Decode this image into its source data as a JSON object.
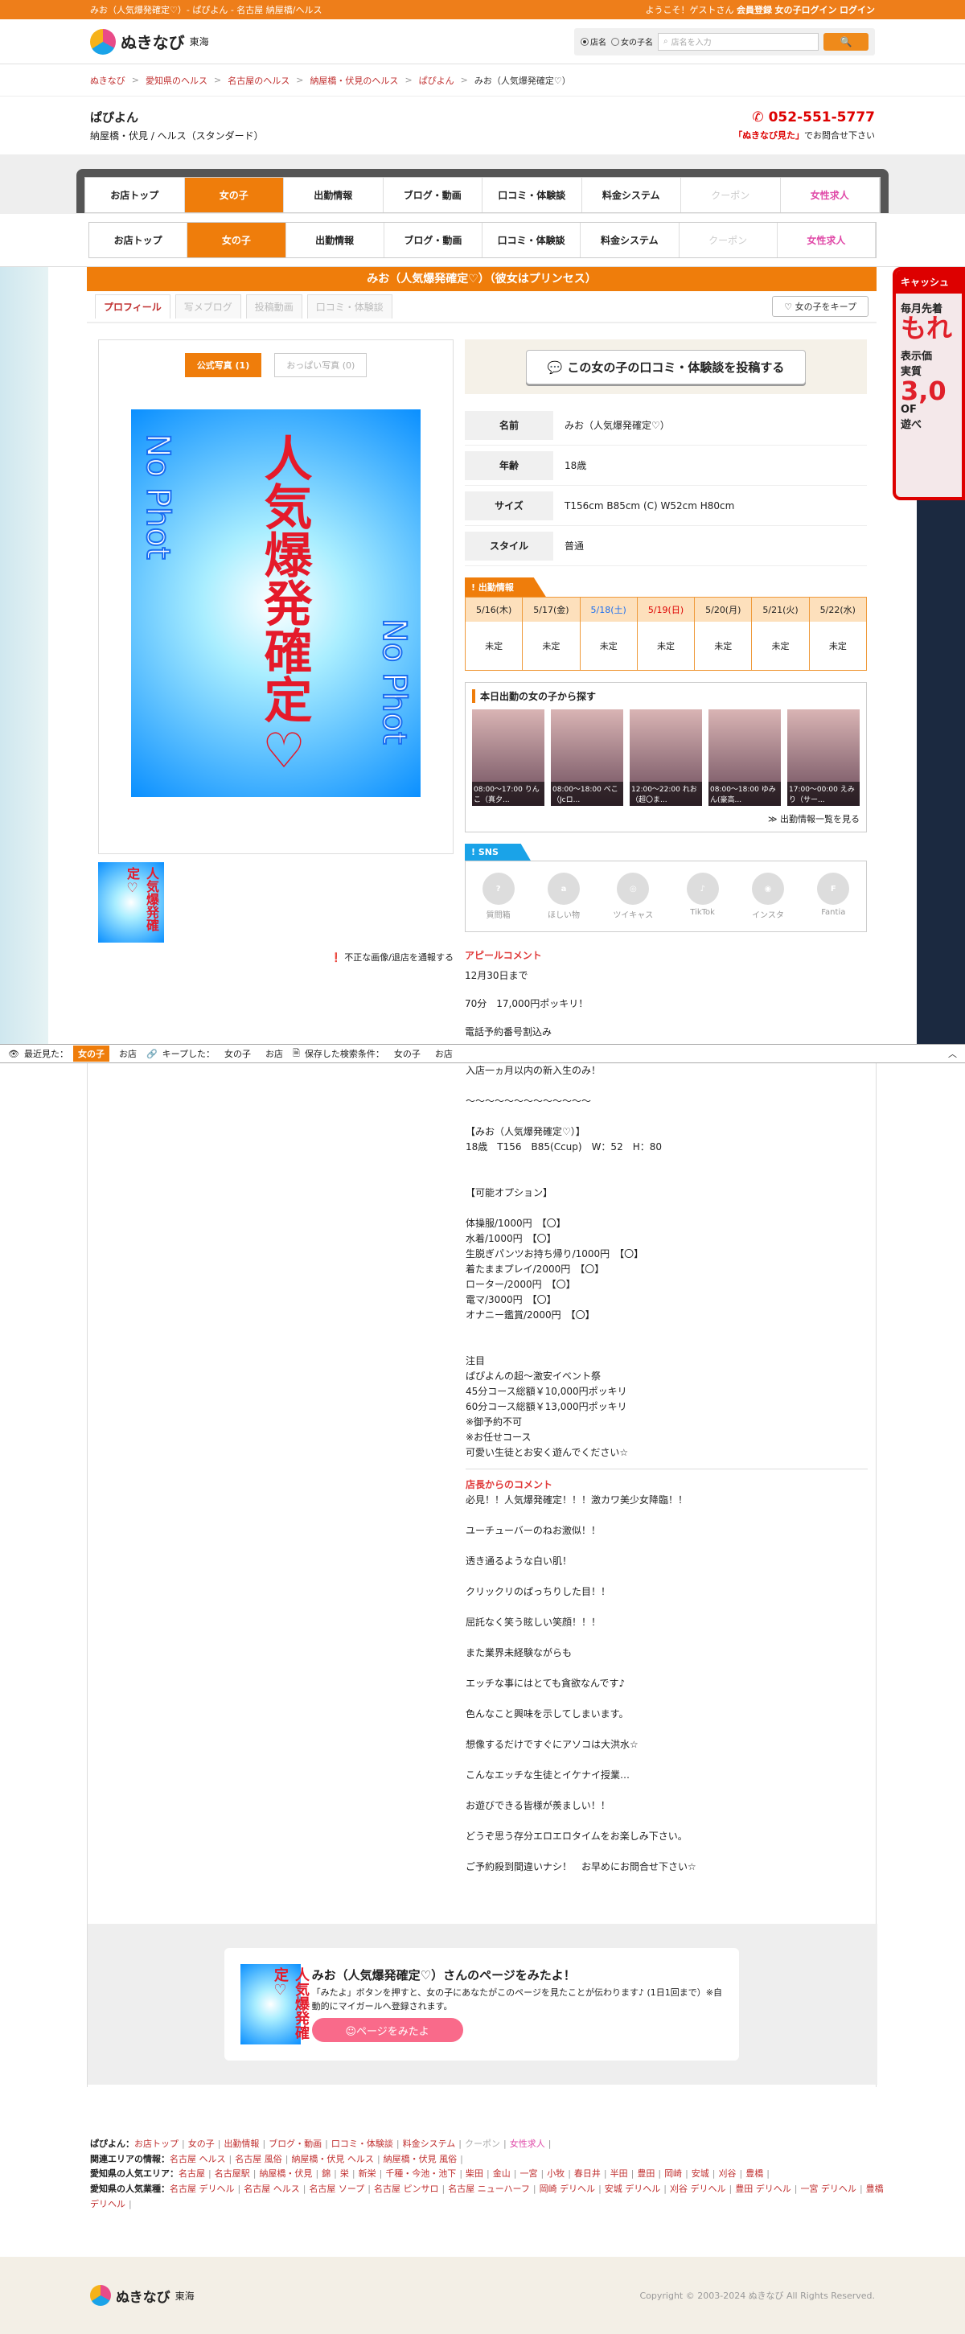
{
  "topbar": {
    "left": "みお（人気爆発確定♡）- ぱぴよん - 名古屋 納屋橋/ヘルス",
    "welcome": "ようこそ！ゲストさん",
    "register": "会員登録",
    "girl_login": "女の子ログイン",
    "login": "ログイン"
  },
  "header": {
    "logo": "ぬきなび",
    "region": "東海",
    "radio_shop": "店名",
    "radio_girl": "女の子名",
    "search_placeholder": "店名を入力",
    "search_button": "🔍"
  },
  "breadcrumb": [
    "ぬきなび",
    "愛知県のヘルス",
    "名古屋のヘルス",
    "納屋橋・伏見のヘルス",
    "ぱぴよん",
    "みお（人気爆発確定♡）"
  ],
  "shop": {
    "name": "ぱぴよん",
    "sub": "納屋橋・伏見 / ヘルス（スタンダード）",
    "tel": "052-551-5777",
    "note_b": "「ぬきなび見た」",
    "note": "でお問合せ下さい"
  },
  "nav": [
    "お店トップ",
    "女の子",
    "出勤情報",
    "ブログ・動画",
    "口コミ・体験談",
    "料金システム",
    "クーポン",
    "女性求人"
  ],
  "side_banner": {
    "t": "キャッシュ",
    "a": "毎月先着",
    "b": "もれ",
    "c": "表示価",
    "d": "実質",
    "big": "3,0",
    "e": "OF",
    "f": "遊べ"
  },
  "title": "みお（人気爆発確定♡）（彼女はプリンセス）",
  "tabs": [
    "プロフィール",
    "写メブログ",
    "投稿動画",
    "口コミ・体験談"
  ],
  "keep": "♡ 女の子をキープ",
  "photo_tabs": [
    "公式写真 (1)",
    "おっぱい写真 (0)"
  ],
  "photo": {
    "big": "人気爆発確定♡",
    "np": "No Phot"
  },
  "report": "不正な画像/退店を通報する",
  "post_button": "この女の子の口コミ・体験談を投稿する",
  "profile": [
    {
      "k": "名前",
      "v": "みお（人気爆発確定♡）"
    },
    {
      "k": "年齢",
      "v": "18歳"
    },
    {
      "k": "サイズ",
      "v": "T156cm B85cm (C) W52cm H80cm"
    },
    {
      "k": "スタイル",
      "v": "普通"
    }
  ],
  "schedule_head": "出勤情報",
  "schedule": [
    {
      "d": "5/16(木)",
      "s": "未定"
    },
    {
      "d": "5/17(金)",
      "s": "未定"
    },
    {
      "d": "5/18(土)",
      "s": "未定"
    },
    {
      "d": "5/19(日)",
      "s": "未定"
    },
    {
      "d": "5/20(月)",
      "s": "未定"
    },
    {
      "d": "5/21(火)",
      "s": "未定"
    },
    {
      "d": "5/22(水)",
      "s": "未定"
    }
  ],
  "today_head": "本日出勤の女の子から探す",
  "today_girls": [
    "08:00～17:00 りんこ（真夕...",
    "08:00～18:00 べこ（Jcロ...",
    "12:00～22:00 れお（超〇ま...",
    "08:00～18:00 ゆみん(豪高...",
    "17:00～00:00 えみり（サー..."
  ],
  "today_more": "≫ 出勤情報一覧を見る",
  "sns_head": "SNS",
  "sns": [
    "質問箱",
    "ほしい物",
    "ツイキャス",
    "TikTok",
    "インスタ",
    "Fantia"
  ],
  "appeal_head": "アピールコメント",
  "appeal": [
    "12月30日まで",
    "70分　17,000円ポッキリ！",
    "電話予約番号割込み"
  ],
  "low_lines": [
    "入店一ヵ月以内の新入生のみ！",
    "",
    "〜〜〜〜〜〜〜〜〜〜〜〜〜",
    "",
    "【みお（人気爆発確定♡）】",
    "18歳　T156　B85(Ccup)　W：52　H：80",
    "",
    "",
    "【可能オプション】",
    "",
    "体操服/1000円　【〇】",
    "水着/1000円　【〇】",
    "生脱ぎパンツお持ち帰り/1000円　【〇】",
    "着たままプレイ/2000円　【〇】",
    "ローター/2000円　【〇】",
    "電マ/3000円　【〇】",
    "オナニー鑑賞/2000円　【〇】",
    "",
    "",
    "注目",
    "ぱぴよんの超〜激安イベント祭",
    "45分コース総額￥10,000円ポッキリ",
    "60分コース総額￥13,000円ポッキリ",
    "※御予約不可",
    "※お任せコース",
    "可愛い生徒とお安く遊んでください☆"
  ],
  "manager_head": "店長からのコメント",
  "manager_lines": [
    "必見！！人気爆発確定！！！激カワ美少女降臨！！",
    "",
    "ユーチューバーのねお激似！！",
    "",
    "透き通るような白い肌！",
    "",
    "クリックリのぱっちりした目！！",
    "",
    "屈託なく笑う眩しい笑顔！！！",
    "",
    "また業界未経験ながらも",
    "",
    "エッチな事にはとても貪欲なんです♪",
    "",
    "色んなこと興味を示してしまいます。",
    "",
    "想像するだけですぐにアソコは大洪水☆",
    "",
    "こんなエッチな生徒とイケナイ授業…",
    "",
    "お遊びできる皆様が羨ましい！！",
    "",
    "どうぞ思う存分エロエロタイムをお楽しみ下さい。",
    "",
    "ご予約殺到間違いナシ！　お早めにお問合せ下さい☆"
  ],
  "bottombar": {
    "seen": "最近見た：",
    "girl": "女の子",
    "shop": "お店",
    "kept": "キープした：",
    "saved": "保存した検索条件："
  },
  "mitayo": {
    "title": "みお（人気爆発確定♡）さんのページをみたよ！",
    "desc": "「みたよ」ボタンを押すと、女の子にあなたがこのページを見たことが伝わります♪ (1日1回まで）※自動的にマイガールへ登録されます。",
    "button": "☺ページをみたよ"
  },
  "footer": {
    "row1_label": "ぱぴよん：",
    "row1": [
      "お店トップ",
      "女の子",
      "出勤情報",
      "ブログ・動画",
      "口コミ・体験談",
      "料金システム",
      "クーポン",
      "女性求人"
    ],
    "row2_label": "関連エリアの情報：",
    "row2": [
      "名古屋 ヘルス",
      "名古屋 風俗",
      "納屋橋・伏見 ヘルス",
      "納屋橋・伏見 風俗"
    ],
    "row3_label": "愛知県の人気エリア：",
    "row3": [
      "名古屋",
      "名古屋駅",
      "納屋橋・伏見",
      "錦",
      "栄",
      "新栄",
      "千種・今池・池下",
      "柴田",
      "金山",
      "一宮",
      "小牧",
      "春日井",
      "半田",
      "豊田",
      "岡崎",
      "安城",
      "刈谷",
      "豊橋"
    ],
    "row4_label": "愛知県の人気業種：",
    "row4": [
      "名古屋 デリヘル",
      "名古屋 ヘルス",
      "名古屋 ソープ",
      "名古屋 ピンサロ",
      "名古屋 ニューハーフ",
      "岡崎 デリヘル",
      "安城 デリヘル",
      "刈谷 デリヘル",
      "豊田 デリヘル",
      "一宮 デリヘル",
      "豊橋 デリヘル"
    ],
    "copyright": "Copyright © 2003-2024 ぬきなび All Rights Reserved."
  }
}
